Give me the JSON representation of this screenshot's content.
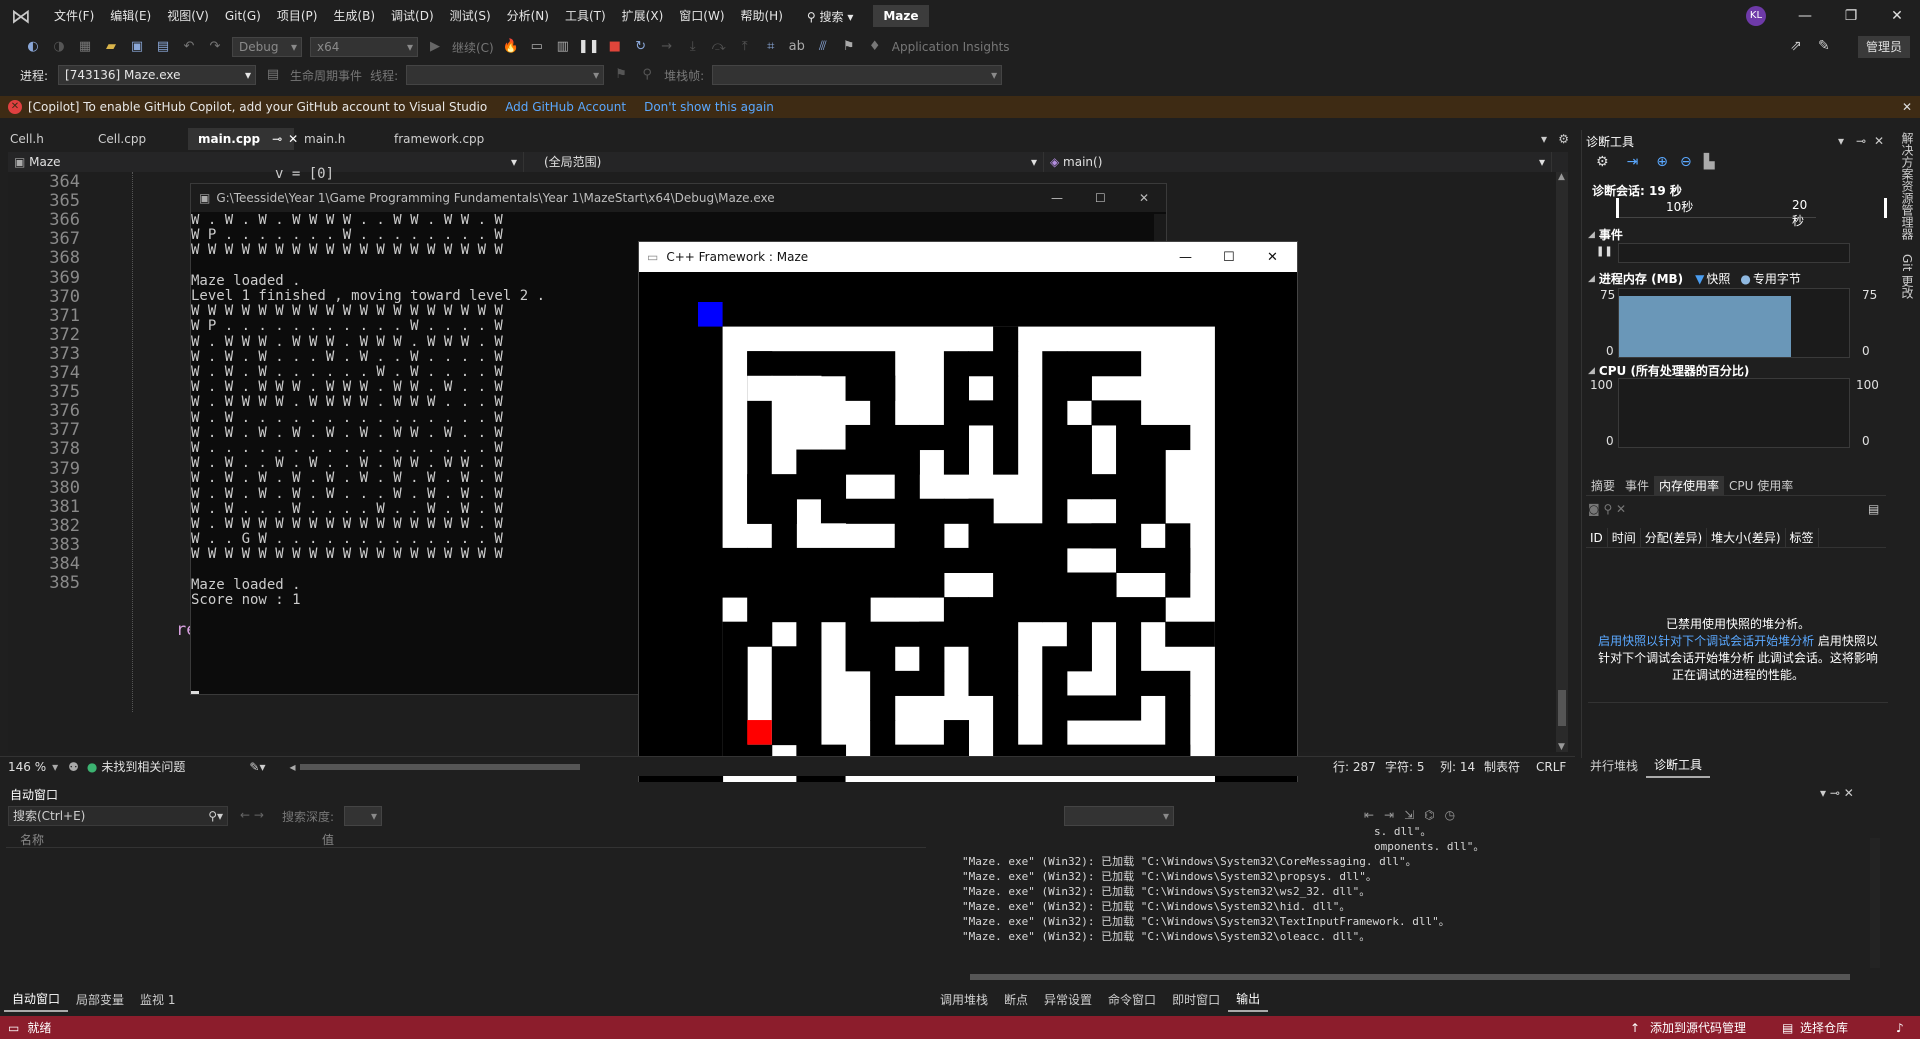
{
  "menubar": {
    "items": [
      "文件(F)",
      "编辑(E)",
      "视图(V)",
      "Git(G)",
      "项目(P)",
      "生成(B)",
      "调试(D)",
      "测试(S)",
      "分析(N)",
      "工具(T)",
      "扩展(X)",
      "窗口(W)",
      "帮助(H)"
    ],
    "search_label": "搜索",
    "solution": "Maze",
    "avatar_initials": "KL"
  },
  "toolbar": {
    "config": "Debug",
    "platform": "x64",
    "continue": "继续(C)",
    "app_insights": "Application Insights",
    "admin": "管理员",
    "process_label": "进程:",
    "process_value": "[743136] Maze.exe",
    "lifecycle_label": "生命周期事件",
    "thread_label": "线程:",
    "stackframe_label": "堆栈帧:"
  },
  "banner": {
    "text": "[Copilot] To enable GitHub Copilot, add your GitHub account to Visual Studio",
    "link1": "Add GitHub Account",
    "link2": "Don't show this again"
  },
  "tabs": [
    "Cell.h",
    "Cell.cpp",
    "main.cpp",
    "main.h",
    "framework.cpp"
  ],
  "active_tab": "main.cpp",
  "navbar": {
    "project": "Maze",
    "scope": "(全局范围)",
    "function": "main()"
  },
  "editor": {
    "line_numbers": [
      "364",
      "365",
      "366",
      "367",
      "368",
      "369",
      "370",
      "371",
      "372",
      "373",
      "374",
      "375",
      "376",
      "377",
      "378",
      "379",
      "380",
      "381",
      "382",
      "383",
      "384",
      "385"
    ],
    "partial_text_top": "v = [0]",
    "partial_text_re": "re"
  },
  "console": {
    "title": "G:\\Teesside\\Year 1\\Game Programming Fundamentals\\Year 1\\MazeStart\\x64\\Debug\\Maze.exe",
    "lines": [
      "W . W . W . W W W W . . W W . W W . W",
      "W P . . . . . . . W . . . . . . . . W",
      "W W W W W W W W W W W W W W W W W W W",
      "",
      "Maze loaded .",
      "Level 1 finished , moving toward level 2 .",
      "W W W W W W W W W W W W W W W W W W W",
      "W P . . . . . . . . . . . W . . . . W",
      "W . W W W . W W W . W W W . W W W . W",
      "W . W . W . . . W . W . . W . . . . W",
      "W . W . W . . . . . . W . W . . . . W",
      "W . W . W W W . W W W . W W . W . . W",
      "W . W W W W . W W W W . W W W . . . W",
      "W . W . . . . . . . . . . . . . . . W",
      "W . W . W . W . W . W . W W . W . . W",
      "W . . . . . . . . . . . . . . . . . W",
      "W . W . . W . W . . W . W W . W W . W",
      "W . W . W . W . W . W . W . W . W . W",
      "W . W . W . W . W . . . W . W . W . W",
      "W . W . . . W . . . . W . . W . W . W",
      "W . W W W W W W W W W W W W W W W . W",
      "W . . G W . . . . . . . . . . . . . W",
      "W W W W W W W W W W W W W W W W W W W",
      "",
      "Maze loaded .",
      "Score now : 1"
    ]
  },
  "game": {
    "title": "C++ Framework : Maze",
    "colors": {
      "wall": "#000000",
      "floor": "#ffffff",
      "player": "#0000ff",
      "goal": "#ff0000"
    }
  },
  "diag": {
    "title": "诊断工具",
    "session": "诊断会话: 19 秒",
    "tick1": "10秒",
    "tick2": "20秒",
    "events_label": "事件",
    "memory_label": "进程内存 (MB)",
    "snapshot_legend": "快照",
    "private_legend": "专用字节",
    "mem_max": "75",
    "mem_min": "0",
    "cpu_label": "CPU (所有处理器的百分比)",
    "cpu_max": "100",
    "cpu_min": "0",
    "tabs": [
      "摘要",
      "事件",
      "内存使用率",
      "CPU 使用率"
    ],
    "table_cols": [
      "ID",
      "时间",
      "分配(差异)",
      "堆大小(差异)",
      "标签"
    ],
    "msg1": "已禁用使用快照的堆分析。",
    "msg2_link": "启用快照以针对下个调试会话开始堆分析",
    "msg2_rest": " 启用快照以",
    "msg3": "针对下个调试会话开始堆分析 此调试会话。这将影响",
    "msg4": "正在调试的进程的性能。",
    "bottom_tabs": [
      "并行堆栈",
      "诊断工具"
    ],
    "memory_level": 0.9
  },
  "sidetabs": [
    "解决方案资源管理器",
    "Git 更改"
  ],
  "edstatus": {
    "zoom": "146 %",
    "issues": "未找到相关问题",
    "line": "行: 287",
    "char": "字符: 5",
    "col": "列: 14",
    "tabs": "制表符",
    "eol": "CRLF"
  },
  "autowin": {
    "title": "自动窗口",
    "search_placeholder": "搜索(Ctrl+E)",
    "depth_label": "搜索深度:",
    "col_name": "名称",
    "col_value": "值",
    "tabs": [
      "自动窗口",
      "局部变量",
      "监视 1"
    ]
  },
  "outwin": {
    "partial1": "s. dll\"。",
    "partial2": "omponents. dll\"。",
    "lines": [
      "\"Maze. exe\" (Win32): 已加载 \"C:\\Windows\\System32\\CoreMessaging. dll\"。",
      "\"Maze. exe\" (Win32): 已加载 \"C:\\Windows\\System32\\propsys. dll\"。",
      "\"Maze. exe\" (Win32): 已加载 \"C:\\Windows\\System32\\ws2_32. dll\"。",
      "\"Maze. exe\" (Win32): 已加载 \"C:\\Windows\\System32\\hid. dll\"。",
      "\"Maze. exe\" (Win32): 已加载 \"C:\\Windows\\System32\\TextInputFramework. dll\"。",
      "\"Maze. exe\" (Win32): 已加载 \"C:\\Windows\\System32\\oleacc. dll\"。"
    ],
    "tabs": [
      "调用堆栈",
      "断点",
      "异常设置",
      "命令窗口",
      "即时窗口",
      "输出"
    ]
  },
  "statusbar": {
    "ready": "就绪",
    "add_source": "添加到源代码管理",
    "select_repo": "选择仓库"
  }
}
